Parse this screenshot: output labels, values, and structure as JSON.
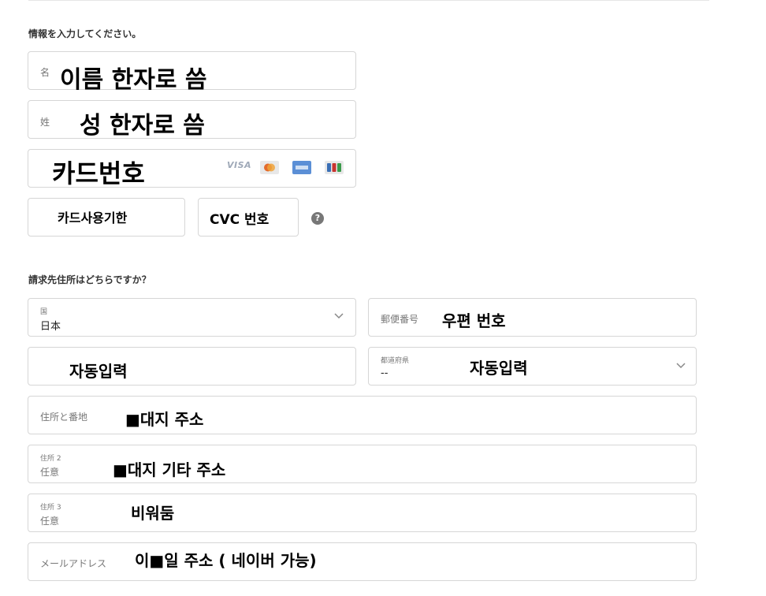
{
  "card_section": {
    "heading": "情報を入力してください。",
    "first_name": {
      "label": "名",
      "overlay": "이름 한자로 씀"
    },
    "last_name": {
      "label": "姓",
      "overlay": "성 한자로 씀"
    },
    "card_number": {
      "overlay": "카드번호",
      "brands": [
        "VISA",
        "mastercard-icon",
        "amex-icon",
        "jcb-icon"
      ],
      "visa_label": "VISA"
    },
    "expiry": {
      "overlay": "카드사용기한"
    },
    "cvc": {
      "overlay": "CVC 번호",
      "help": "?"
    }
  },
  "address_section": {
    "heading": "請求先住所はどちらですか？",
    "country": {
      "label": "国",
      "value": "日本"
    },
    "postal": {
      "label": "郵便番号",
      "overlay": "우편 번호"
    },
    "city": {
      "overlay": "자동입력"
    },
    "prefecture": {
      "label": "都道府県",
      "value": "--",
      "overlay": "자동입력"
    },
    "address1": {
      "label": "住所と番地",
      "overlay": "■대지 주소"
    },
    "address2": {
      "label": "住所 2",
      "sub": "任意",
      "overlay": "■대지 기타 주소"
    },
    "address3": {
      "label": "住所 3",
      "sub": "任意",
      "overlay": "비워둠"
    },
    "email": {
      "label": "メールアドレス",
      "overlay": "이■일 주소 ( 네이버 가능)"
    }
  },
  "colors": {
    "border": "#d6d6d6",
    "mastercard": "#e36b2c",
    "amex": "#5b8fd6",
    "jcb": "#c9342f"
  }
}
